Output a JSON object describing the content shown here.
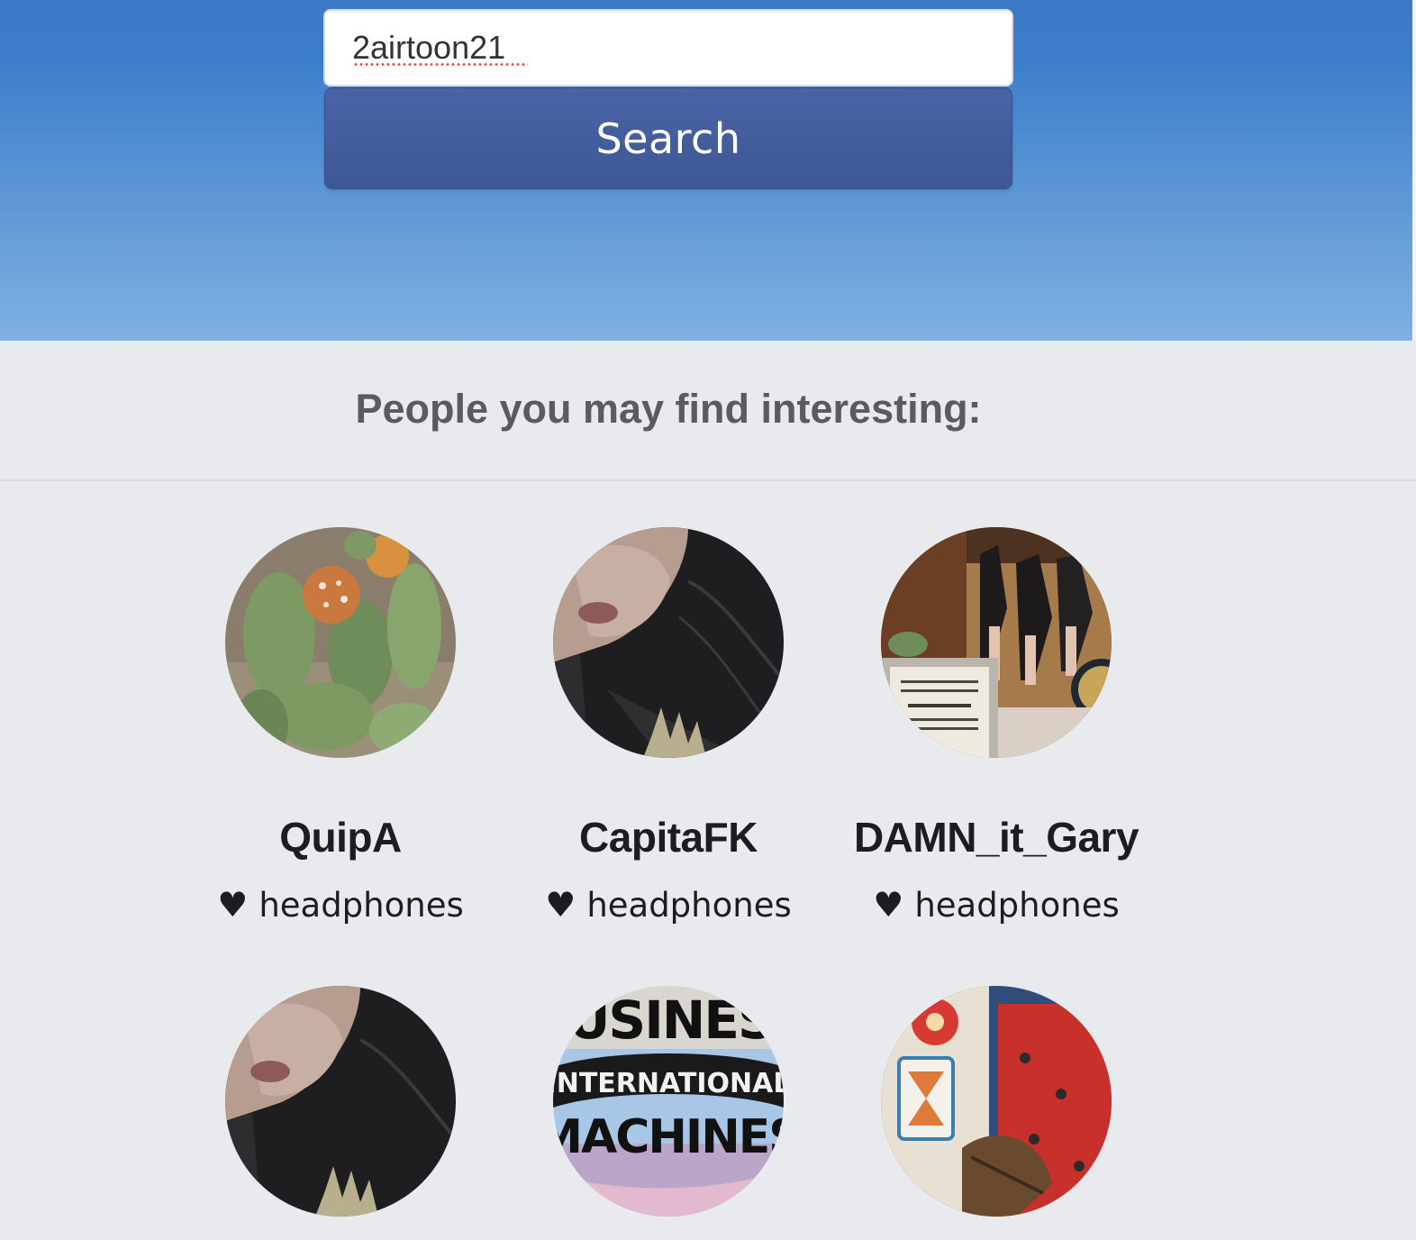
{
  "search": {
    "value": "2airtoon21",
    "button_label": "Search"
  },
  "suggestions": {
    "title": "People you may find interesting:",
    "people": [
      {
        "username": "QuipA",
        "interest": "headphones",
        "avatar_icon": "cactus-photo-avatar"
      },
      {
        "username": "CapitaFK",
        "interest": "headphones",
        "avatar_icon": "dog-photo-avatar"
      },
      {
        "username": "DAMN_it_Gary",
        "interest": "headphones",
        "avatar_icon": "dancers-photo-avatar"
      },
      {
        "username": "",
        "interest": "",
        "avatar_icon": "dog-photo-avatar"
      },
      {
        "username": "",
        "interest": "",
        "avatar_icon": "business-machines-globe-avatar"
      },
      {
        "username": "",
        "interest": "",
        "avatar_icon": "regalia-photo-avatar"
      }
    ]
  },
  "business_avatar_text": {
    "line1": "BUSINESS",
    "line2": "INTERNATIONAL",
    "line3": "MACHINES"
  },
  "colors": {
    "hero_blue": "#3d80cb",
    "button_blue": "#425c9c",
    "page_bg": "#e9eaee"
  },
  "icons": {
    "heart": "heart-icon"
  }
}
